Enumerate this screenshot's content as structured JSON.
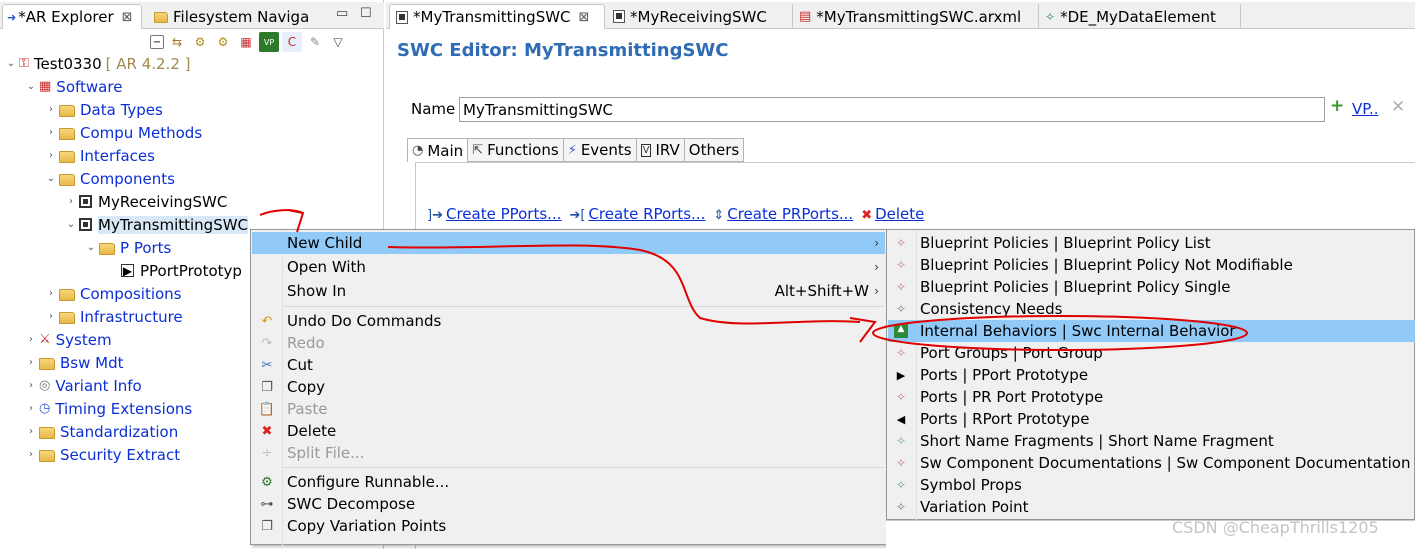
{
  "left_panel": {
    "tabs": [
      {
        "label": "*AR Explorer",
        "close": "⊠"
      },
      {
        "label": "Filesystem Naviga"
      }
    ],
    "window_controls": [
      "▭",
      "☐"
    ]
  },
  "tree": {
    "root": {
      "label": "Test0330",
      "version": "[ AR 4.2.2 ]"
    },
    "software": "Software",
    "data_types": "Data Types",
    "compu_methods": "Compu Methods",
    "interfaces": "Interfaces",
    "components": "Components",
    "receiving_swc": "MyReceivingSWC",
    "transmitting_swc": "MyTransmittingSWC",
    "p_ports": "P Ports",
    "pport_prototype": "PPortPrototyp",
    "compositions": "Compositions",
    "infrastructure": "Infrastructure",
    "system": "System",
    "bsw_mdt": "Bsw Mdt",
    "variant_info": "Variant Info",
    "timing_extensions": "Timing Extensions",
    "standardization": "Standardization",
    "security_extract": "Security Extract"
  },
  "editor": {
    "tabs": [
      {
        "label": "*MyTransmittingSWC",
        "close": "⊠"
      },
      {
        "label": "*MyReceivingSWC"
      },
      {
        "label": "*MyTransmittingSWC.arxml"
      },
      {
        "label": "*DE_MyDataElement"
      }
    ],
    "title": "SWC Editor: MyTransmittingSWC",
    "name_label": "Name",
    "name_value": "MyTransmittingSWC",
    "vp_link": "VP..",
    "sub_tabs": [
      "Main",
      "Functions",
      "Events",
      "IRV",
      "Others"
    ],
    "actions": [
      "Create PPorts...",
      "Create RPorts...",
      "Create PRPorts...",
      "Delete"
    ]
  },
  "context_menu": {
    "new_child": "New Child",
    "open_with": "Open With",
    "show_in": "Show In",
    "show_in_shortcut": "Alt+Shift+W",
    "undo": "Undo Do Commands",
    "redo": "Redo",
    "cut": "Cut",
    "copy": "Copy",
    "paste": "Paste",
    "delete": "Delete",
    "split_file": "Split File...",
    "configure_runnable": "Configure Runnable...",
    "swc_decompose": "SWC Decompose",
    "copy_variation_points": "Copy Variation Points"
  },
  "submenu": [
    "Blueprint Policies | Blueprint Policy List",
    "Blueprint Policies | Blueprint Policy Not Modifiable",
    "Blueprint Policies | Blueprint Policy Single",
    "Consistency Needs",
    "Internal Behaviors | Swc Internal Behavior",
    "Port Groups | Port Group",
    "Ports | PPort Prototype",
    "Ports | PR Port Prototype",
    "Ports | RPort Prototype",
    "Short Name Fragments | Short Name Fragment",
    "Sw Component Documentations | Sw Component Documentation",
    "Symbol Props",
    "Variation Point"
  ],
  "watermark": "CSDN @CheapThrills1205",
  "colors": {
    "highlight": "#91c9f7",
    "link": "#0a2fd6",
    "title": "#2f6cb5",
    "annotation": "#e00000"
  }
}
